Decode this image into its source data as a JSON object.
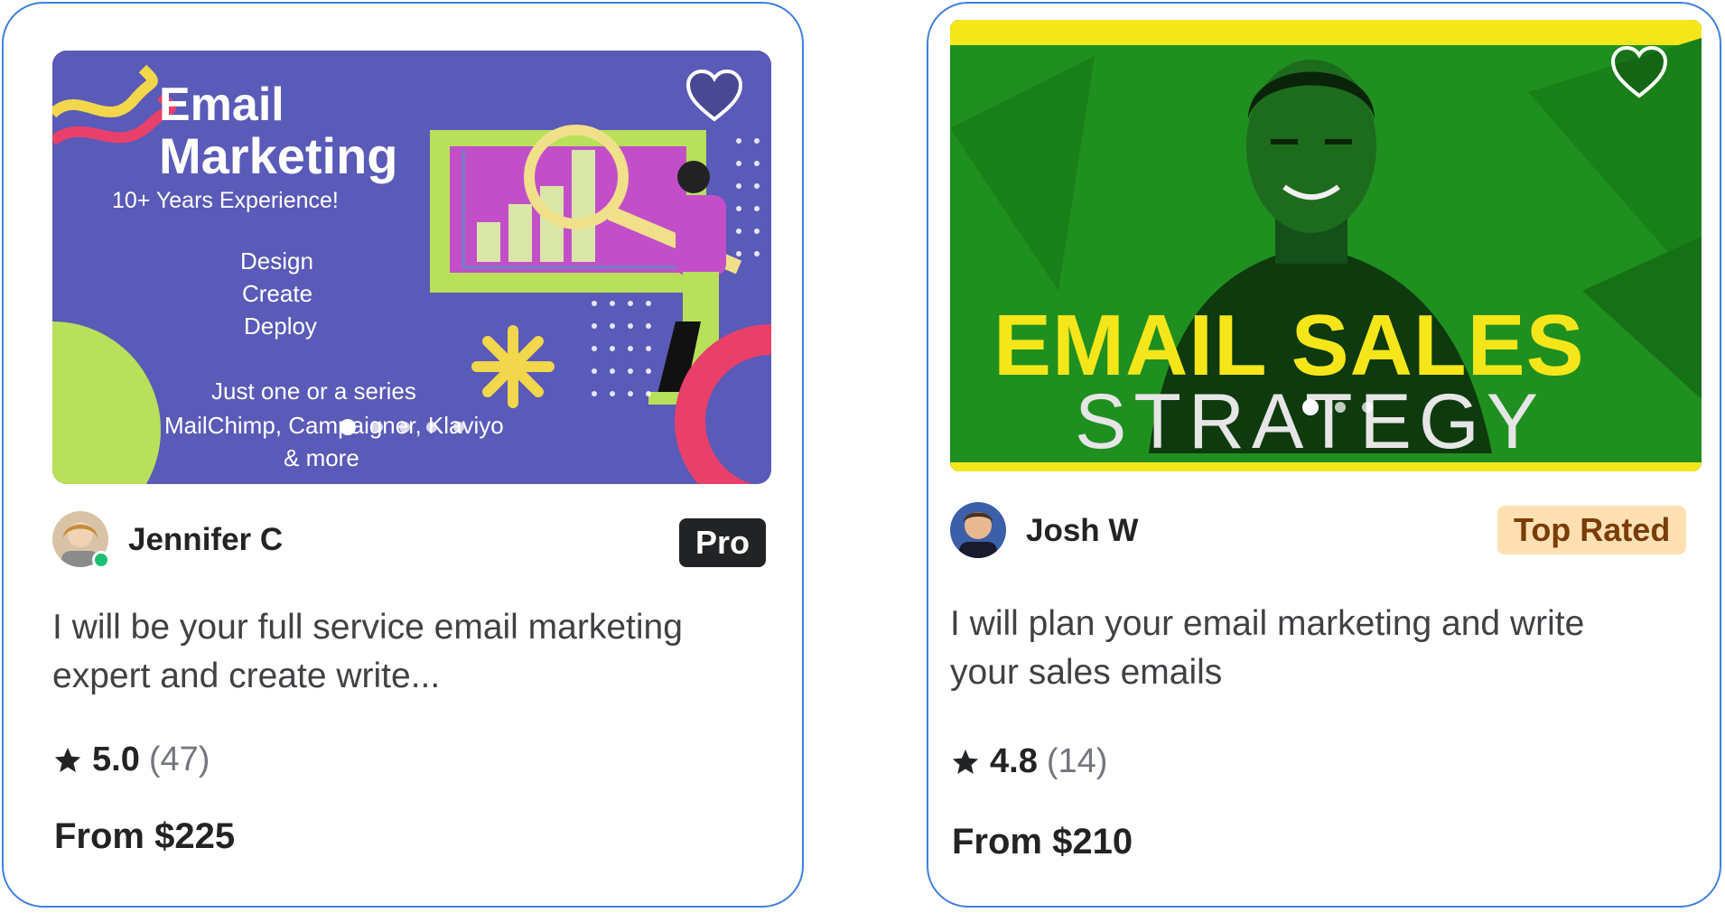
{
  "colors": {
    "card_border": "#3f7fe0",
    "online": "#1dbf73",
    "pro_badge_bg": "#222325",
    "top_rated_bg": "#ffe0b3",
    "top_rated_text": "#7a3d06"
  },
  "gigs": [
    {
      "thumbnail": {
        "heading_line1": "Email",
        "heading_line2": "Marketing",
        "tagline": "10+ Years Experience!",
        "steps": [
          "Design",
          "Create",
          "Deploy"
        ],
        "footer_line1": "Just one or a series",
        "footer_line2": "MailChimp, Campaigner, Klaviyo",
        "footer_line3": "& more",
        "slide_count": 5,
        "active_slide": 1
      },
      "seller": {
        "name": "Jennifer C",
        "online": true
      },
      "badge": "Pro",
      "title": "I will be your full service email marketing expert and create write...",
      "rating": "5.0",
      "reviews": "(47)",
      "price": "From $225",
      "favorite_icon": "heart-outline-icon"
    },
    {
      "thumbnail": {
        "heading_line1": "EMAIL SALES",
        "heading_line2": "STRATEGY",
        "slide_count": 3,
        "active_slide": 1
      },
      "seller": {
        "name": "Josh W",
        "online": false
      },
      "badge": "Top Rated",
      "title": "I will plan your email marketing and write your sales emails",
      "rating": "4.8",
      "reviews": "(14)",
      "price": "From $210",
      "favorite_icon": "heart-outline-icon"
    }
  ]
}
